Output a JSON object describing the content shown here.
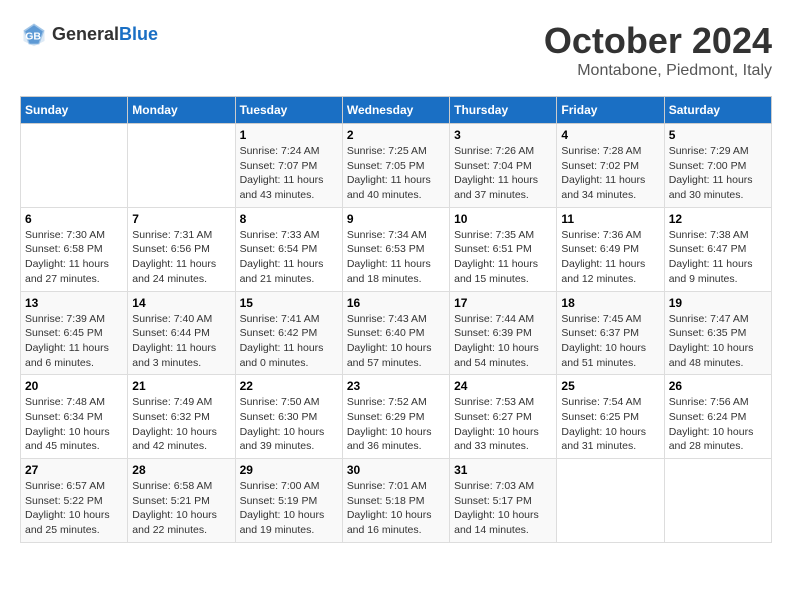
{
  "header": {
    "logo": {
      "general": "General",
      "blue": "Blue"
    },
    "title": "October 2024",
    "location": "Montabone, Piedmont, Italy"
  },
  "weekdays": [
    "Sunday",
    "Monday",
    "Tuesday",
    "Wednesday",
    "Thursday",
    "Friday",
    "Saturday"
  ],
  "weeks": [
    [
      {
        "day": "",
        "info": ""
      },
      {
        "day": "",
        "info": ""
      },
      {
        "day": "1",
        "info": "Sunrise: 7:24 AM\nSunset: 7:07 PM\nDaylight: 11 hours and 43 minutes."
      },
      {
        "day": "2",
        "info": "Sunrise: 7:25 AM\nSunset: 7:05 PM\nDaylight: 11 hours and 40 minutes."
      },
      {
        "day": "3",
        "info": "Sunrise: 7:26 AM\nSunset: 7:04 PM\nDaylight: 11 hours and 37 minutes."
      },
      {
        "day": "4",
        "info": "Sunrise: 7:28 AM\nSunset: 7:02 PM\nDaylight: 11 hours and 34 minutes."
      },
      {
        "day": "5",
        "info": "Sunrise: 7:29 AM\nSunset: 7:00 PM\nDaylight: 11 hours and 30 minutes."
      }
    ],
    [
      {
        "day": "6",
        "info": "Sunrise: 7:30 AM\nSunset: 6:58 PM\nDaylight: 11 hours and 27 minutes."
      },
      {
        "day": "7",
        "info": "Sunrise: 7:31 AM\nSunset: 6:56 PM\nDaylight: 11 hours and 24 minutes."
      },
      {
        "day": "8",
        "info": "Sunrise: 7:33 AM\nSunset: 6:54 PM\nDaylight: 11 hours and 21 minutes."
      },
      {
        "day": "9",
        "info": "Sunrise: 7:34 AM\nSunset: 6:53 PM\nDaylight: 11 hours and 18 minutes."
      },
      {
        "day": "10",
        "info": "Sunrise: 7:35 AM\nSunset: 6:51 PM\nDaylight: 11 hours and 15 minutes."
      },
      {
        "day": "11",
        "info": "Sunrise: 7:36 AM\nSunset: 6:49 PM\nDaylight: 11 hours and 12 minutes."
      },
      {
        "day": "12",
        "info": "Sunrise: 7:38 AM\nSunset: 6:47 PM\nDaylight: 11 hours and 9 minutes."
      }
    ],
    [
      {
        "day": "13",
        "info": "Sunrise: 7:39 AM\nSunset: 6:45 PM\nDaylight: 11 hours and 6 minutes."
      },
      {
        "day": "14",
        "info": "Sunrise: 7:40 AM\nSunset: 6:44 PM\nDaylight: 11 hours and 3 minutes."
      },
      {
        "day": "15",
        "info": "Sunrise: 7:41 AM\nSunset: 6:42 PM\nDaylight: 11 hours and 0 minutes."
      },
      {
        "day": "16",
        "info": "Sunrise: 7:43 AM\nSunset: 6:40 PM\nDaylight: 10 hours and 57 minutes."
      },
      {
        "day": "17",
        "info": "Sunrise: 7:44 AM\nSunset: 6:39 PM\nDaylight: 10 hours and 54 minutes."
      },
      {
        "day": "18",
        "info": "Sunrise: 7:45 AM\nSunset: 6:37 PM\nDaylight: 10 hours and 51 minutes."
      },
      {
        "day": "19",
        "info": "Sunrise: 7:47 AM\nSunset: 6:35 PM\nDaylight: 10 hours and 48 minutes."
      }
    ],
    [
      {
        "day": "20",
        "info": "Sunrise: 7:48 AM\nSunset: 6:34 PM\nDaylight: 10 hours and 45 minutes."
      },
      {
        "day": "21",
        "info": "Sunrise: 7:49 AM\nSunset: 6:32 PM\nDaylight: 10 hours and 42 minutes."
      },
      {
        "day": "22",
        "info": "Sunrise: 7:50 AM\nSunset: 6:30 PM\nDaylight: 10 hours and 39 minutes."
      },
      {
        "day": "23",
        "info": "Sunrise: 7:52 AM\nSunset: 6:29 PM\nDaylight: 10 hours and 36 minutes."
      },
      {
        "day": "24",
        "info": "Sunrise: 7:53 AM\nSunset: 6:27 PM\nDaylight: 10 hours and 33 minutes."
      },
      {
        "day": "25",
        "info": "Sunrise: 7:54 AM\nSunset: 6:25 PM\nDaylight: 10 hours and 31 minutes."
      },
      {
        "day": "26",
        "info": "Sunrise: 7:56 AM\nSunset: 6:24 PM\nDaylight: 10 hours and 28 minutes."
      }
    ],
    [
      {
        "day": "27",
        "info": "Sunrise: 6:57 AM\nSunset: 5:22 PM\nDaylight: 10 hours and 25 minutes."
      },
      {
        "day": "28",
        "info": "Sunrise: 6:58 AM\nSunset: 5:21 PM\nDaylight: 10 hours and 22 minutes."
      },
      {
        "day": "29",
        "info": "Sunrise: 7:00 AM\nSunset: 5:19 PM\nDaylight: 10 hours and 19 minutes."
      },
      {
        "day": "30",
        "info": "Sunrise: 7:01 AM\nSunset: 5:18 PM\nDaylight: 10 hours and 16 minutes."
      },
      {
        "day": "31",
        "info": "Sunrise: 7:03 AM\nSunset: 5:17 PM\nDaylight: 10 hours and 14 minutes."
      },
      {
        "day": "",
        "info": ""
      },
      {
        "day": "",
        "info": ""
      }
    ]
  ]
}
